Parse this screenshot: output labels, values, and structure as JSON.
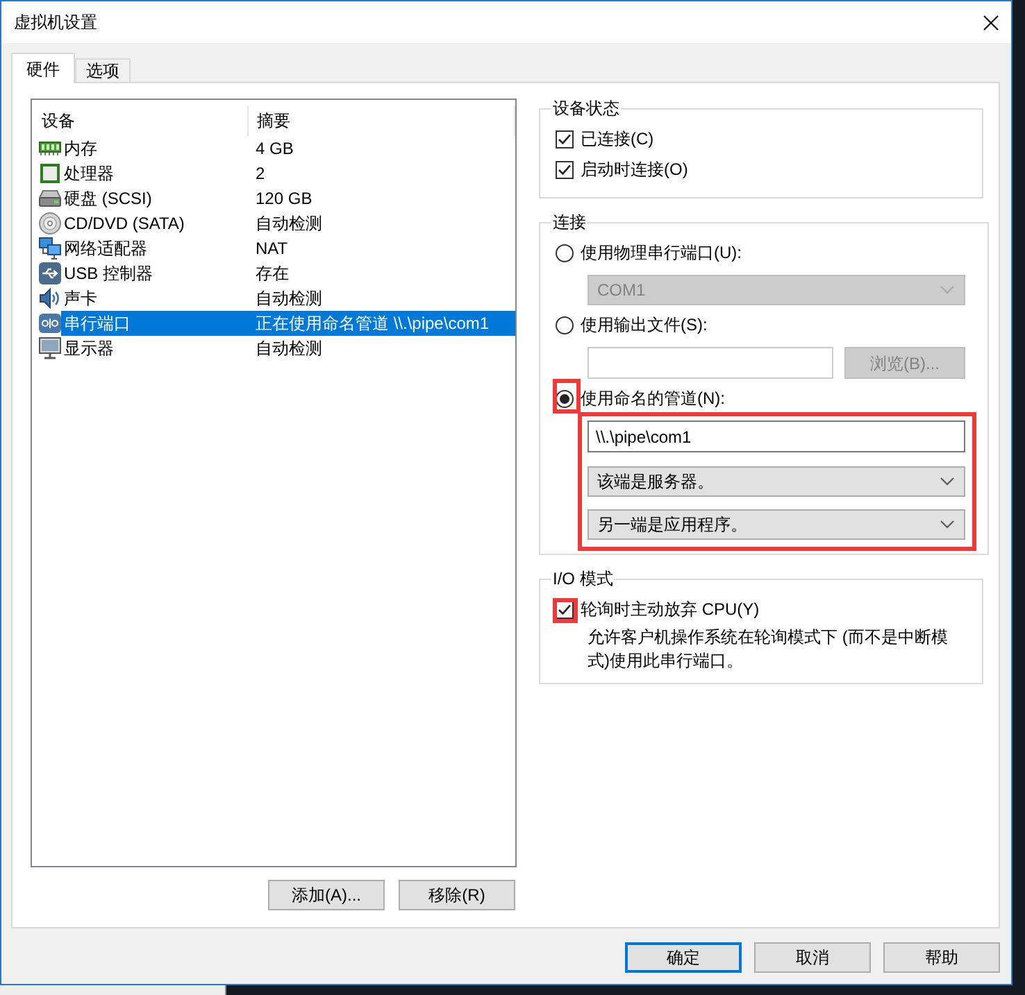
{
  "window": {
    "title": "虚拟机设置"
  },
  "tabs": [
    {
      "label": "硬件",
      "selected": true
    },
    {
      "label": "选项",
      "selected": false
    }
  ],
  "device_list": {
    "columns": [
      "设备",
      "摘要"
    ],
    "rows": [
      {
        "kind": "memory",
        "device": "内存",
        "summary": "4 GB",
        "selected": false
      },
      {
        "kind": "processor",
        "device": "处理器",
        "summary": "2",
        "selected": false
      },
      {
        "kind": "disk",
        "device": "硬盘 (SCSI)",
        "summary": "120 GB",
        "selected": false
      },
      {
        "kind": "optical",
        "device": "CD/DVD (SATA)",
        "summary": "自动检测",
        "selected": false
      },
      {
        "kind": "network",
        "device": "网络适配器",
        "summary": "NAT",
        "selected": false
      },
      {
        "kind": "usb",
        "device": "USB 控制器",
        "summary": "存在",
        "selected": false
      },
      {
        "kind": "sound",
        "device": "声卡",
        "summary": "自动检测",
        "selected": false
      },
      {
        "kind": "serial",
        "device": "串行端口",
        "summary": "正在使用命名管道 \\\\.\\pipe\\com1",
        "selected": true
      },
      {
        "kind": "display",
        "device": "显示器",
        "summary": "自动检测",
        "selected": false
      }
    ]
  },
  "list_buttons": [
    "添加(A)...",
    "移除(R)"
  ],
  "device_status": {
    "title": "设备状态",
    "options": [
      {
        "label": "已连接(C)",
        "checked": true
      },
      {
        "label": "启动时连接(O)",
        "checked": true
      }
    ]
  },
  "connection": {
    "title": "连接",
    "options": [
      {
        "label": "使用物理串行端口(U):",
        "selected": false,
        "highlighted": false,
        "fields_highlighted": false,
        "controls": [
          {
            "kind": "dropdown",
            "value": "COM1",
            "disabled": true
          }
        ]
      },
      {
        "label": "使用输出文件(S):",
        "selected": false,
        "highlighted": false,
        "fields_highlighted": false,
        "controls": [
          {
            "kind": "file_picker",
            "button": "浏览(B)...",
            "disabled": true
          }
        ]
      },
      {
        "label": "使用命名的管道(N):",
        "selected": true,
        "highlighted": true,
        "fields_highlighted": true,
        "controls": [
          {
            "kind": "text_field",
            "value": "\\\\.\\pipe\\com1",
            "disabled": false
          },
          {
            "kind": "dropdown",
            "value": "该端是服务器。",
            "disabled": false
          },
          {
            "kind": "dropdown",
            "value": "另一端是应用程序。",
            "disabled": false
          }
        ]
      }
    ]
  },
  "io_mode": {
    "title": "I/O 模式",
    "option": {
      "label": "轮询时主动放弃 CPU(Y)",
      "checked": true,
      "highlighted": true
    },
    "description": "允许客户机操作系统在轮询模式下 (而不是中断模式)使用此串行端口。"
  },
  "dialog_buttons": [
    {
      "label": "确定",
      "default": true
    },
    {
      "label": "取消",
      "default": false
    },
    {
      "label": "帮助",
      "default": false
    }
  ]
}
